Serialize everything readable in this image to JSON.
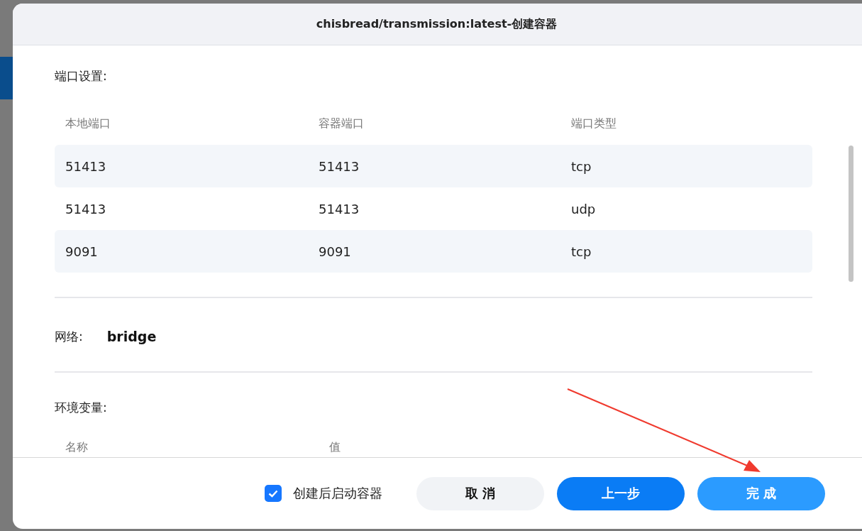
{
  "dialog": {
    "title": "chisbread/transmission:latest-创建容器"
  },
  "ports": {
    "label": "端口设置:",
    "columns": [
      "本地端口",
      "容器端口",
      "端口类型"
    ],
    "rows": [
      [
        "51413",
        "51413",
        "tcp"
      ],
      [
        "51413",
        "51413",
        "udp"
      ],
      [
        "9091",
        "9091",
        "tcp"
      ]
    ]
  },
  "network": {
    "label": "网络:",
    "value": "bridge"
  },
  "env": {
    "label": "环境变量:",
    "columns": [
      "名称",
      "值"
    ]
  },
  "footer": {
    "start_after_create": {
      "label": "创建后启动容器",
      "checked": true
    },
    "buttons": [
      {
        "label": "取 消",
        "kind": "secondary"
      },
      {
        "label": "上一步",
        "kind": "primary"
      },
      {
        "label": "完 成",
        "kind": "confirm"
      }
    ]
  }
}
